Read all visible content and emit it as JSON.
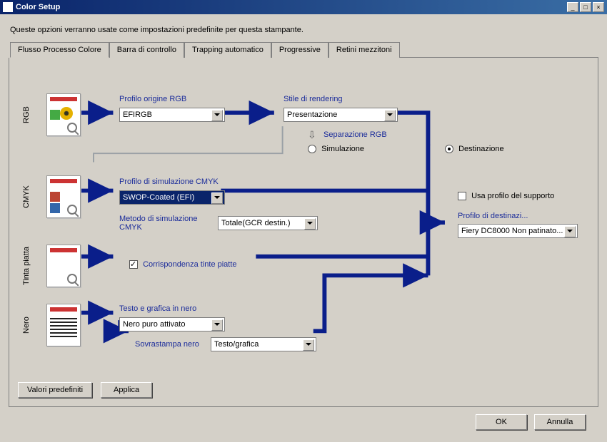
{
  "window": {
    "title": "Color Setup",
    "subtitle": "Queste opzioni verranno usate come impostazioni predefinite per questa stampante."
  },
  "tabs": [
    "Flusso Processo Colore",
    "Barra di controllo",
    "Trapping automatico",
    "Progressive",
    "Retini mezzitoni"
  ],
  "rows": {
    "rgb": "RGB",
    "cmyk": "CMYK",
    "spot": "Tinta piatta",
    "black": "Nero"
  },
  "labels": {
    "rgb_source": "Profilo origine RGB",
    "rendering_style": "Stile di rendering",
    "rgb_separation": "Separazione RGB",
    "simulation": "Simulazione",
    "destination": "Destinazione",
    "cmyk_sim_profile": "Profilo di simulazione CMYK",
    "cmyk_sim_method": "Metodo di simulazione CMYK",
    "use_media_profile": "Usa profilo del supporto",
    "dest_profile": "Profilo di destinazi...",
    "spot_match": "Corrispondenza tinte piatte",
    "black_text": "Testo e grafica in nero",
    "black_overprint": "Sovrastampa nero"
  },
  "values": {
    "rgb_source": "EFIRGB",
    "rendering_style": "Presentazione",
    "cmyk_profile": "SWOP-Coated (EFI)",
    "cmyk_method": "Totale(GCR destin.)",
    "dest_profile": "Fiery DC8000 Non patinato...",
    "black_text": "Nero puro attivato",
    "black_overprint": "Testo/grafica"
  },
  "buttons": {
    "defaults": "Valori predefiniti",
    "apply": "Applica",
    "ok": "OK",
    "cancel": "Annulla"
  },
  "colors": {
    "tint": "#1a2b9a",
    "flow_arrow": "#0a1e8a"
  }
}
